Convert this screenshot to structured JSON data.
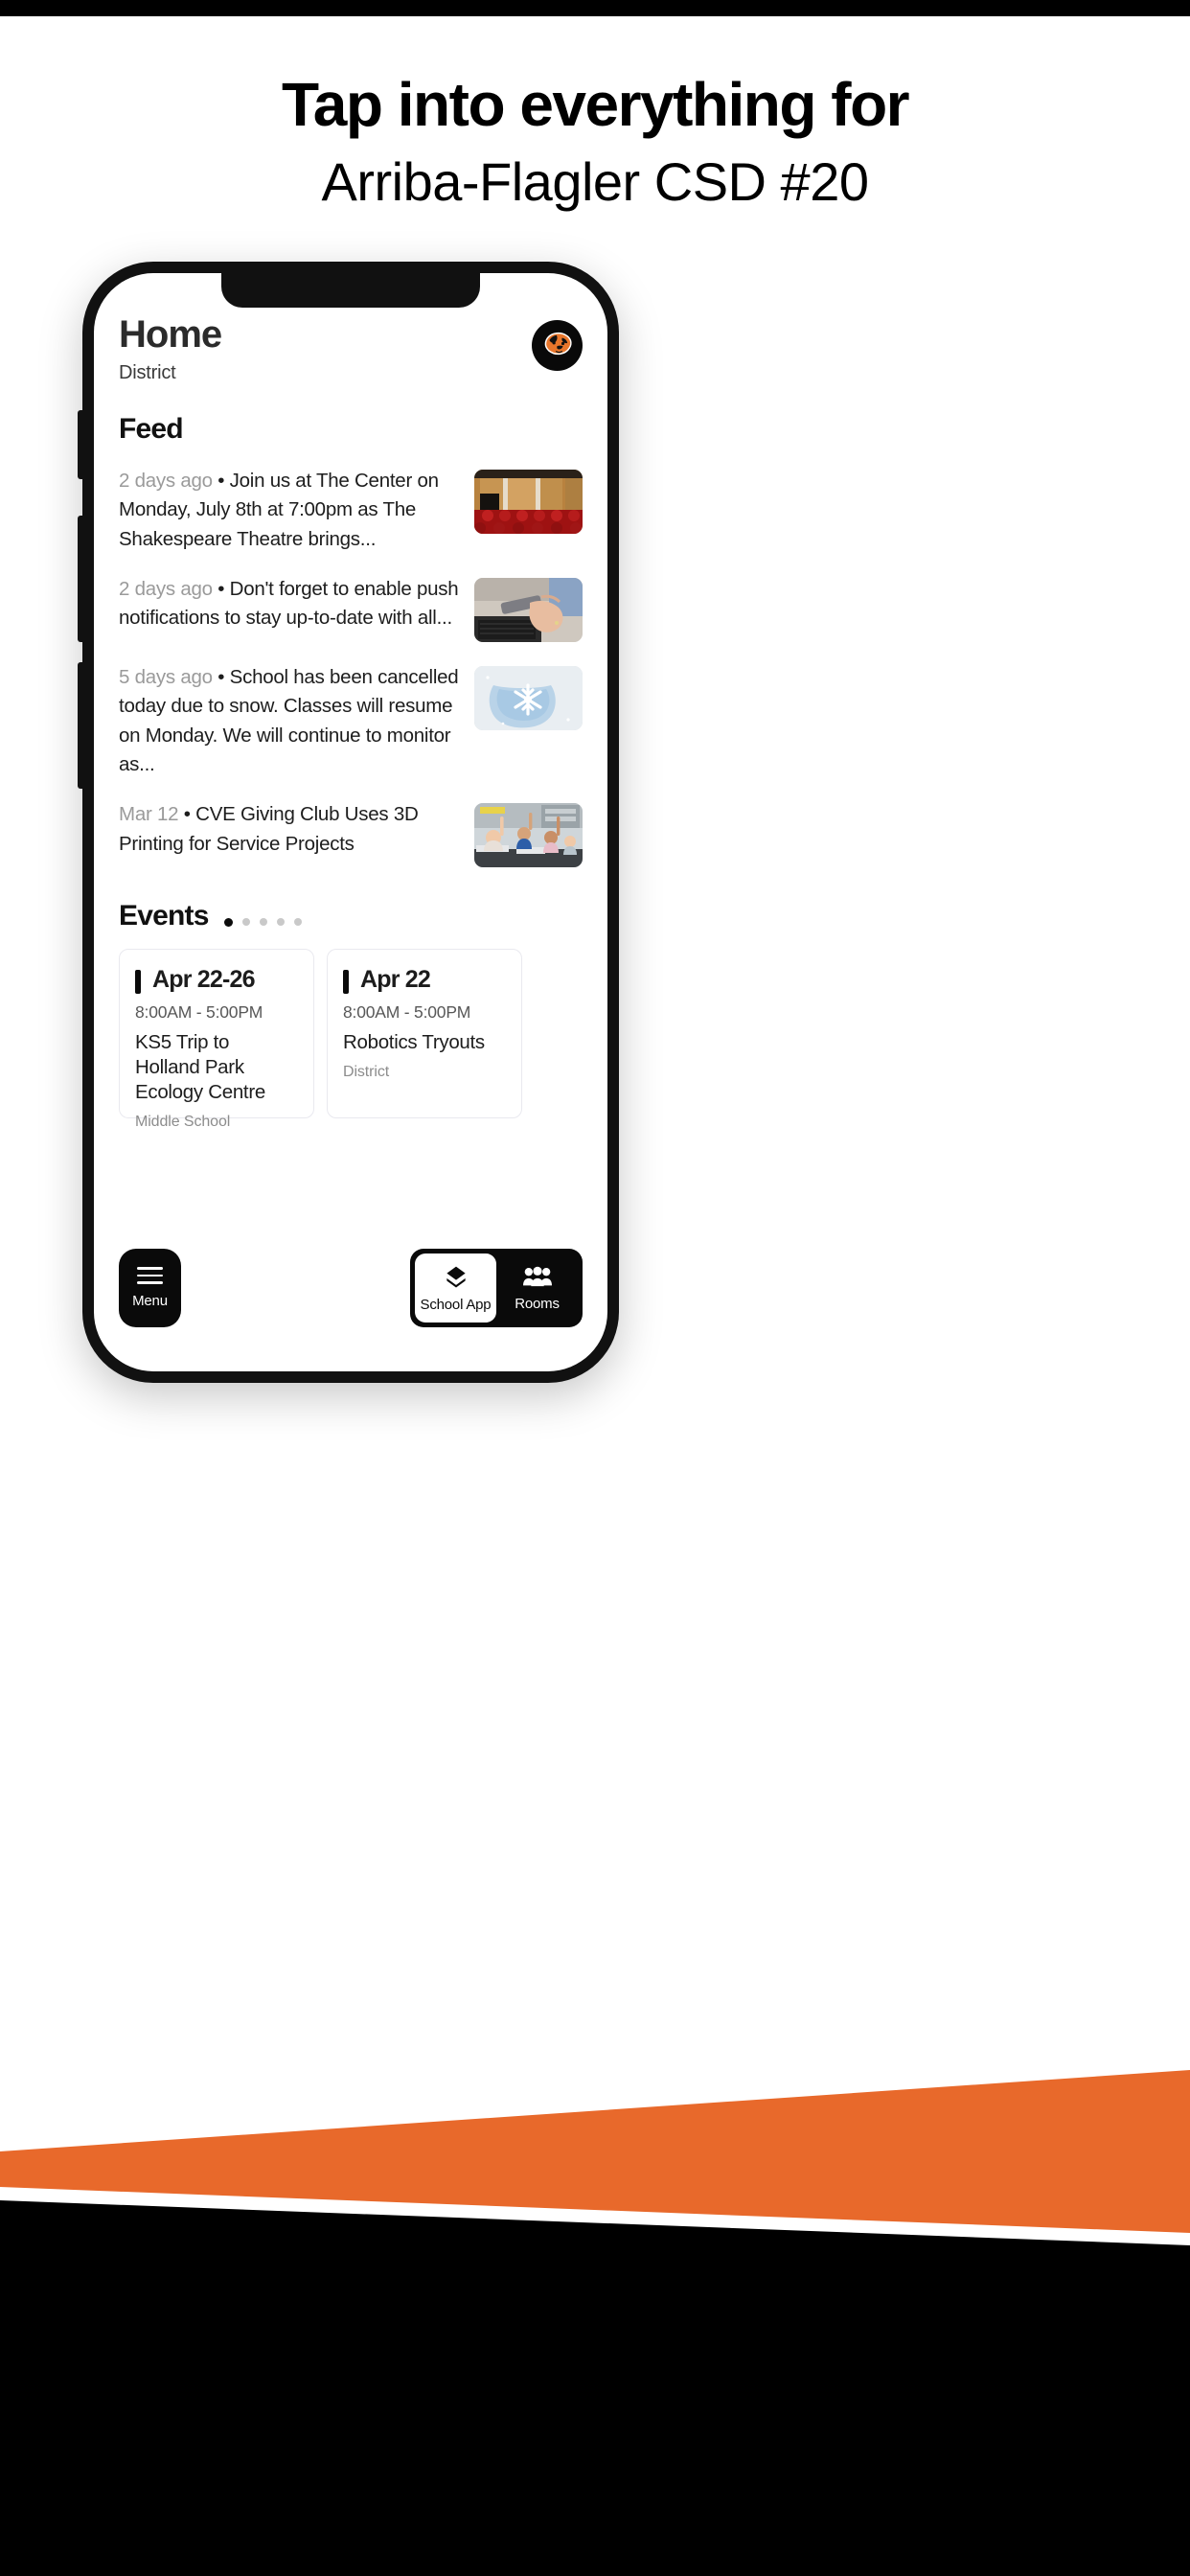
{
  "promo": {
    "headline_line1": "Tap into everything for",
    "headline_line2": "Arriba-Flagler CSD #20"
  },
  "colors": {
    "accent_orange": "#E8692B",
    "black": "#0A0A0A",
    "muted_text": "#9A9A9A",
    "card_border": "#E9E9EF"
  },
  "app": {
    "header": {
      "title": "Home",
      "subtitle": "District",
      "avatar_icon": "panther-mascot-icon"
    },
    "feed": {
      "heading": "Feed",
      "items": [
        {
          "time": "2 days ago",
          "bullet": "•",
          "text": "Join us at The Center on Monday, July 8th at 7:00pm as The Shakespeare Theatre brings...",
          "thumb": "theater-seats-thumbnail"
        },
        {
          "time": "2 days ago",
          "bullet": "•",
          "text": "Don't forget to enable push notifications to stay up-to-date with all...",
          "thumb": "hands-phone-laptop-thumbnail"
        },
        {
          "time": "5 days ago",
          "bullet": "•",
          "text": "School has been cancelled today due to snow. Classes will resume on Monday. We will continue to monitor as...",
          "thumb": "snowflake-mittens-thumbnail"
        },
        {
          "time": "Mar 12",
          "bullet": "•",
          "text": "CVE Giving Club Uses 3D Printing for Service Projects",
          "thumb": "classroom-students-thumbnail"
        }
      ]
    },
    "events": {
      "heading": "Events",
      "dots_total": 5,
      "dots_active_index": 0,
      "cards": [
        {
          "date": "Apr 22-26",
          "time": "8:00AM  -  5:00PM",
          "name": "KS5 Trip to Holland Park Ecology Centre",
          "scope": "Middle School"
        },
        {
          "date": "Apr 22",
          "time": "8:00AM  -  5:00PM",
          "name": "Robotics Tryouts",
          "scope": "District"
        }
      ]
    },
    "bottom_nav": {
      "menu": {
        "label": "Menu",
        "icon": "hamburger-menu-icon"
      },
      "tabs": [
        {
          "label": "School App",
          "icon": "layers-stack-icon",
          "active": true
        },
        {
          "label": "Rooms",
          "icon": "people-group-icon",
          "active": false
        }
      ]
    }
  }
}
